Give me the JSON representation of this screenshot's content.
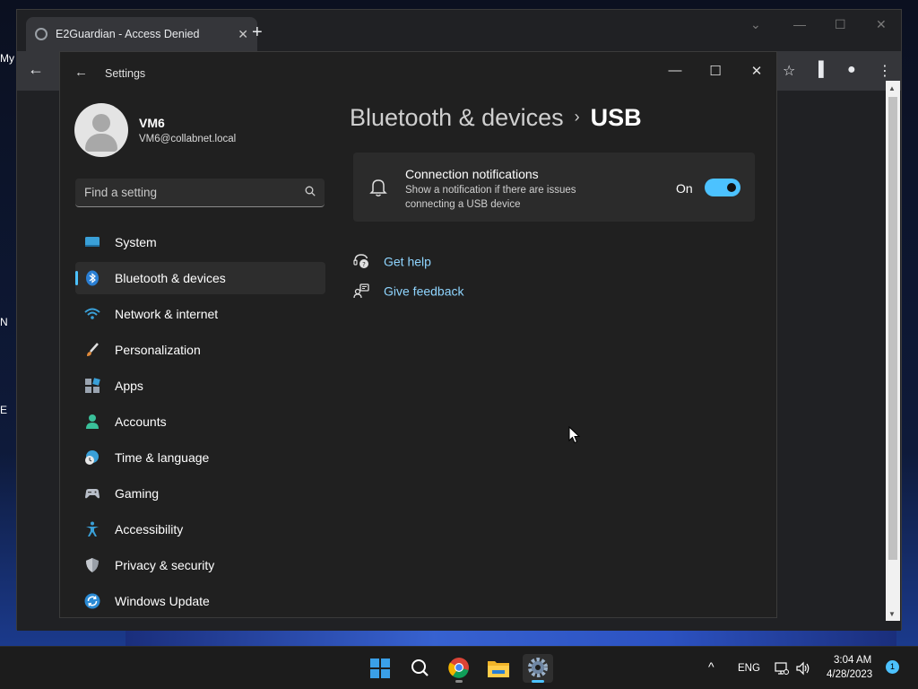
{
  "desktop": {
    "icon_labels": [
      "My",
      "N",
      "E"
    ]
  },
  "chrome": {
    "tab_title": "E2Guardian - Access Denied",
    "tab_close": "✕",
    "new_tab": "+",
    "back": "←",
    "min": "⌄"
  },
  "settings": {
    "window_title": "Settings",
    "back_glyph": "←",
    "min_glyph": "—",
    "max_glyph": "☐",
    "close_glyph": "✕",
    "profile": {
      "name": "VM6",
      "email": "VM6@collabnet.local"
    },
    "search": {
      "placeholder": "Find a setting"
    },
    "nav": [
      {
        "label": "System",
        "icon": "system-icon"
      },
      {
        "label": "Bluetooth & devices",
        "icon": "bluetooth-icon",
        "selected": true
      },
      {
        "label": "Network & internet",
        "icon": "wifi-icon"
      },
      {
        "label": "Personalization",
        "icon": "brush-icon"
      },
      {
        "label": "Apps",
        "icon": "apps-icon"
      },
      {
        "label": "Accounts",
        "icon": "accounts-icon"
      },
      {
        "label": "Time & language",
        "icon": "globe-clock-icon"
      },
      {
        "label": "Gaming",
        "icon": "gamepad-icon"
      },
      {
        "label": "Accessibility",
        "icon": "accessibility-icon"
      },
      {
        "label": "Privacy & security",
        "icon": "shield-icon"
      },
      {
        "label": "Windows Update",
        "icon": "update-icon"
      }
    ],
    "breadcrumb": {
      "parent": "Bluetooth & devices",
      "separator": "›",
      "current": "USB"
    },
    "connection_card": {
      "title": "Connection notifications",
      "description": "Show a notification if there are issues connecting a USB device",
      "toggle_label": "On",
      "toggle_on": true
    },
    "links": {
      "get_help": "Get help",
      "give_feedback": "Give feedback"
    }
  },
  "taskbar": {
    "tray_chevron": "^",
    "language": "ENG",
    "time": "3:04 AM",
    "date": "4/28/2023",
    "notification_count": "1"
  },
  "colors": {
    "accent": "#4cc2ff",
    "window_bg": "#202020",
    "card_bg": "#2b2b2b",
    "link": "#8fd5ff"
  }
}
